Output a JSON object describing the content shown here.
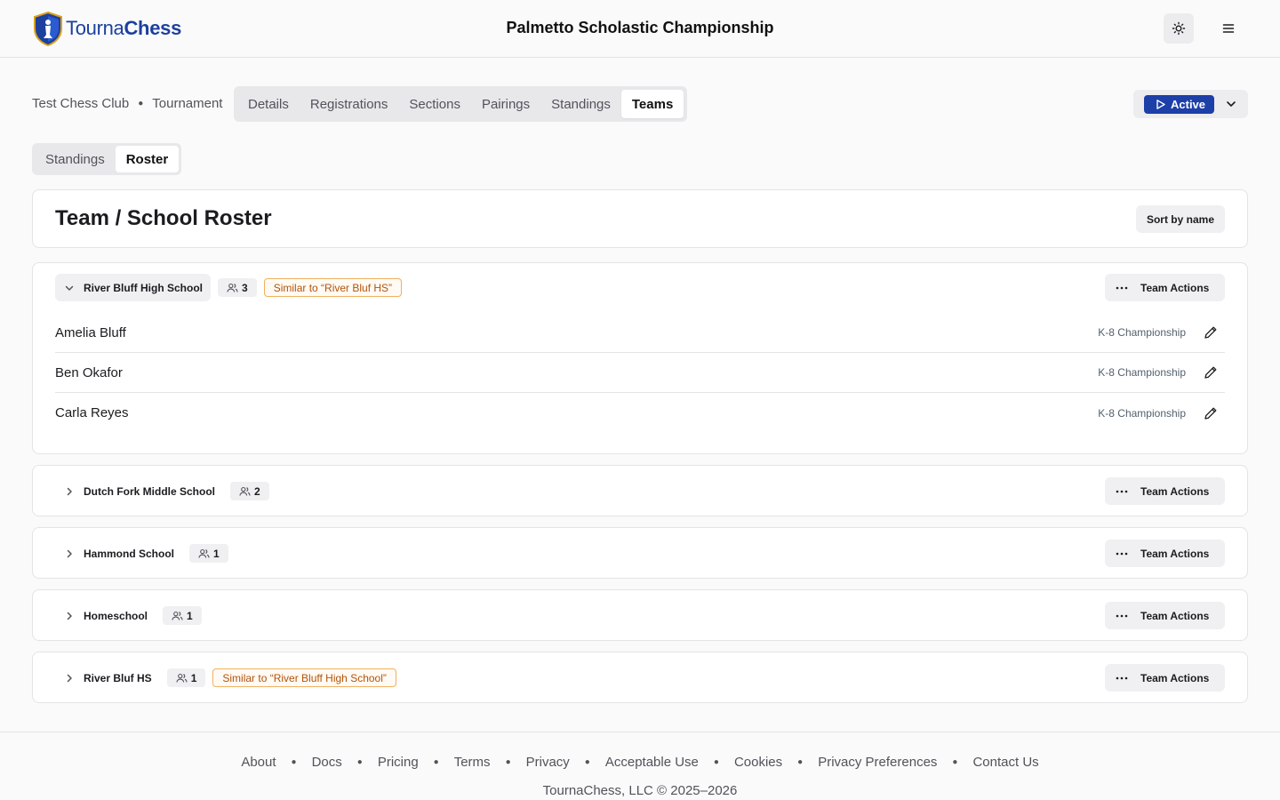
{
  "header": {
    "logo_part1": "Tourna",
    "logo_part2": "Chess",
    "title": "Palmetto Scholastic Championship"
  },
  "breadcrumb": [
    "Test Chess Club",
    "Tournament"
  ],
  "tabs": [
    "Details",
    "Registrations",
    "Sections",
    "Pairings",
    "Standings",
    "Teams"
  ],
  "active_tab": "Teams",
  "status": {
    "label": "Active",
    "color": "#1d3fa8"
  },
  "subtabs": [
    "Standings",
    "Roster"
  ],
  "active_subtab": "Roster",
  "roster": {
    "title": "Team / School Roster",
    "sort_label": "Sort by name",
    "actions_label": "Team Actions",
    "teams": [
      {
        "name": "River Bluff High School",
        "count": "3",
        "expanded": true,
        "similar": "Similar to “River Bluf HS”",
        "members": [
          {
            "name": "Amelia Bluff",
            "section": "K-8 Championship"
          },
          {
            "name": "Ben Okafor",
            "section": "K-8 Championship"
          },
          {
            "name": "Carla Reyes",
            "section": "K-8 Championship"
          }
        ]
      },
      {
        "name": "Dutch Fork Middle School",
        "count": "2",
        "expanded": false
      },
      {
        "name": "Hammond School",
        "count": "1",
        "expanded": false
      },
      {
        "name": "Homeschool",
        "count": "1",
        "expanded": false
      },
      {
        "name": "River Bluf HS",
        "count": "1",
        "expanded": false,
        "similar": "Similar to “River Bluff High School”"
      }
    ]
  },
  "footer": {
    "links": [
      "About",
      "Docs",
      "Pricing",
      "Terms",
      "Privacy",
      "Acceptable Use",
      "Cookies",
      "Privacy Preferences",
      "Contact Us"
    ],
    "copyright": "TournaChess, LLC © 2025–2026"
  }
}
